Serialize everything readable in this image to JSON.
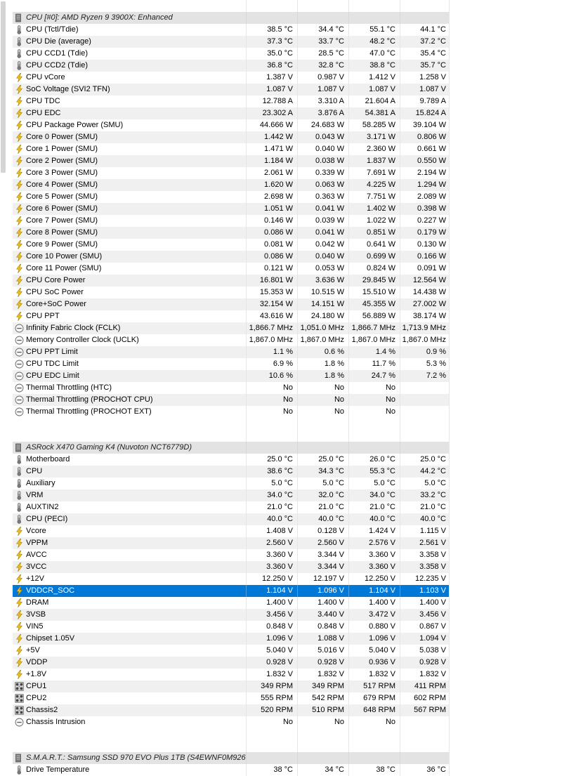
{
  "sections": [
    {
      "title": "CPU [#0]: AMD Ryzen 9 3900X: Enhanced",
      "rows": [
        {
          "icon": "thermometer-icon",
          "label": "CPU (Tctl/Tdie)",
          "v": [
            "38.5 °C",
            "34.4 °C",
            "55.1 °C",
            "44.1 °C"
          ]
        },
        {
          "icon": "thermometer-icon",
          "label": "CPU Die (average)",
          "v": [
            "37.3 °C",
            "33.7 °C",
            "48.2 °C",
            "37.2 °C"
          ]
        },
        {
          "icon": "thermometer-icon",
          "label": "CPU CCD1 (Tdie)",
          "v": [
            "35.0 °C",
            "28.5 °C",
            "47.0 °C",
            "35.4 °C"
          ]
        },
        {
          "icon": "thermometer-icon",
          "label": "CPU CCD2 (Tdie)",
          "v": [
            "36.8 °C",
            "32.8 °C",
            "38.8 °C",
            "35.7 °C"
          ]
        },
        {
          "icon": "lightning-icon",
          "label": "CPU vCore",
          "v": [
            "1.387 V",
            "0.987 V",
            "1.412 V",
            "1.258 V"
          ]
        },
        {
          "icon": "lightning-icon",
          "label": "SoC Voltage (SVI2 TFN)",
          "v": [
            "1.087 V",
            "1.087 V",
            "1.087 V",
            "1.087 V"
          ]
        },
        {
          "icon": "lightning-icon",
          "label": "CPU TDC",
          "v": [
            "12.788 A",
            "3.310 A",
            "21.604 A",
            "9.789 A"
          ]
        },
        {
          "icon": "lightning-icon",
          "label": "CPU EDC",
          "v": [
            "23.302 A",
            "3.876 A",
            "54.381 A",
            "15.824 A"
          ]
        },
        {
          "icon": "lightning-icon",
          "label": "CPU Package Power (SMU)",
          "v": [
            "44.666 W",
            "24.683 W",
            "58.285 W",
            "39.104 W"
          ]
        },
        {
          "icon": "lightning-icon",
          "label": "Core 0 Power (SMU)",
          "v": [
            "1.442 W",
            "0.043 W",
            "3.171 W",
            "0.806 W"
          ]
        },
        {
          "icon": "lightning-icon",
          "label": "Core 1 Power (SMU)",
          "v": [
            "1.471 W",
            "0.040 W",
            "2.360 W",
            "0.661 W"
          ]
        },
        {
          "icon": "lightning-icon",
          "label": "Core 2 Power (SMU)",
          "v": [
            "1.184 W",
            "0.038 W",
            "1.837 W",
            "0.550 W"
          ]
        },
        {
          "icon": "lightning-icon",
          "label": "Core 3 Power (SMU)",
          "v": [
            "2.061 W",
            "0.339 W",
            "7.691 W",
            "2.194 W"
          ]
        },
        {
          "icon": "lightning-icon",
          "label": "Core 4 Power (SMU)",
          "v": [
            "1.620 W",
            "0.063 W",
            "4.225 W",
            "1.294 W"
          ]
        },
        {
          "icon": "lightning-icon",
          "label": "Core 5 Power (SMU)",
          "v": [
            "2.698 W",
            "0.363 W",
            "7.751 W",
            "2.089 W"
          ]
        },
        {
          "icon": "lightning-icon",
          "label": "Core 6 Power (SMU)",
          "v": [
            "1.051 W",
            "0.041 W",
            "1.402 W",
            "0.398 W"
          ]
        },
        {
          "icon": "lightning-icon",
          "label": "Core 7 Power (SMU)",
          "v": [
            "0.146 W",
            "0.039 W",
            "1.022 W",
            "0.227 W"
          ]
        },
        {
          "icon": "lightning-icon",
          "label": "Core 8 Power (SMU)",
          "v": [
            "0.086 W",
            "0.041 W",
            "0.851 W",
            "0.179 W"
          ]
        },
        {
          "icon": "lightning-icon",
          "label": "Core 9 Power (SMU)",
          "v": [
            "0.081 W",
            "0.042 W",
            "0.641 W",
            "0.130 W"
          ]
        },
        {
          "icon": "lightning-icon",
          "label": "Core 10 Power (SMU)",
          "v": [
            "0.086 W",
            "0.040 W",
            "0.699 W",
            "0.166 W"
          ]
        },
        {
          "icon": "lightning-icon",
          "label": "Core 11 Power (SMU)",
          "v": [
            "0.121 W",
            "0.053 W",
            "0.824 W",
            "0.091 W"
          ]
        },
        {
          "icon": "lightning-icon",
          "label": "CPU Core Power",
          "v": [
            "16.801 W",
            "3.636 W",
            "29.845 W",
            "12.564 W"
          ]
        },
        {
          "icon": "lightning-icon",
          "label": "CPU SoC Power",
          "v": [
            "15.353 W",
            "10.515 W",
            "15.510 W",
            "14.438 W"
          ]
        },
        {
          "icon": "lightning-icon",
          "label": "Core+SoC Power",
          "v": [
            "32.154 W",
            "14.151 W",
            "45.355 W",
            "27.002 W"
          ]
        },
        {
          "icon": "lightning-icon",
          "label": "CPU PPT",
          "v": [
            "43.616 W",
            "24.180 W",
            "56.889 W",
            "38.174 W"
          ]
        },
        {
          "icon": "circle-minus-icon",
          "label": "Infinity Fabric Clock (FCLK)",
          "v": [
            "1,866.7 MHz",
            "1,051.0 MHz",
            "1,866.7 MHz",
            "1,713.9 MHz"
          ]
        },
        {
          "icon": "circle-minus-icon",
          "label": "Memory Controller Clock (UCLK)",
          "v": [
            "1,867.0 MHz",
            "1,867.0 MHz",
            "1,867.0 MHz",
            "1,867.0 MHz"
          ]
        },
        {
          "icon": "circle-minus-icon",
          "label": "CPU PPT Limit",
          "v": [
            "1.1 %",
            "0.6 %",
            "1.4 %",
            "0.9 %"
          ]
        },
        {
          "icon": "circle-minus-icon",
          "label": "CPU TDC Limit",
          "v": [
            "6.9 %",
            "1.8 %",
            "11.7 %",
            "5.3 %"
          ]
        },
        {
          "icon": "circle-minus-icon",
          "label": "CPU EDC Limit",
          "v": [
            "10.6 %",
            "1.8 %",
            "24.7 %",
            "7.2 %"
          ]
        },
        {
          "icon": "circle-minus-icon",
          "label": "Thermal Throttling (HTC)",
          "v": [
            "No",
            "No",
            "No",
            ""
          ]
        },
        {
          "icon": "circle-minus-icon",
          "label": "Thermal Throttling (PROCHOT CPU)",
          "v": [
            "No",
            "No",
            "No",
            ""
          ]
        },
        {
          "icon": "circle-minus-icon",
          "label": "Thermal Throttling (PROCHOT EXT)",
          "v": [
            "No",
            "No",
            "No",
            ""
          ]
        }
      ]
    },
    {
      "title": "ASRock X470 Gaming K4 (Nuvoton NCT6779D)",
      "rows": [
        {
          "icon": "thermometer-icon",
          "label": "Motherboard",
          "v": [
            "25.0 °C",
            "25.0 °C",
            "26.0 °C",
            "25.0 °C"
          ]
        },
        {
          "icon": "thermometer-icon",
          "label": "CPU",
          "v": [
            "38.6 °C",
            "34.3 °C",
            "55.3 °C",
            "44.2 °C"
          ]
        },
        {
          "icon": "thermometer-icon",
          "label": "Auxiliary",
          "v": [
            "5.0 °C",
            "5.0 °C",
            "5.0 °C",
            "5.0 °C"
          ]
        },
        {
          "icon": "thermometer-icon",
          "label": "VRM",
          "v": [
            "34.0 °C",
            "32.0 °C",
            "34.0 °C",
            "33.2 °C"
          ]
        },
        {
          "icon": "thermometer-icon",
          "label": "AUXTIN2",
          "v": [
            "21.0 °C",
            "21.0 °C",
            "21.0 °C",
            "21.0 °C"
          ]
        },
        {
          "icon": "thermometer-icon",
          "label": "CPU (PECI)",
          "v": [
            "40.0 °C",
            "40.0 °C",
            "40.0 °C",
            "40.0 °C"
          ]
        },
        {
          "icon": "lightning-icon",
          "label": "Vcore",
          "v": [
            "1.408 V",
            "0.128 V",
            "1.424 V",
            "1.115 V"
          ]
        },
        {
          "icon": "lightning-icon",
          "label": "VPPM",
          "v": [
            "2.560 V",
            "2.560 V",
            "2.576 V",
            "2.561 V"
          ]
        },
        {
          "icon": "lightning-icon",
          "label": "AVCC",
          "v": [
            "3.360 V",
            "3.344 V",
            "3.360 V",
            "3.358 V"
          ]
        },
        {
          "icon": "lightning-icon",
          "label": "3VCC",
          "v": [
            "3.360 V",
            "3.344 V",
            "3.360 V",
            "3.358 V"
          ]
        },
        {
          "icon": "lightning-icon",
          "label": "+12V",
          "v": [
            "12.250 V",
            "12.197 V",
            "12.250 V",
            "12.235 V"
          ]
        },
        {
          "icon": "lightning-icon",
          "label": "VDDCR_SOC",
          "v": [
            "1.104 V",
            "1.096 V",
            "1.104 V",
            "1.103 V"
          ],
          "selected": true
        },
        {
          "icon": "lightning-icon",
          "label": "DRAM",
          "v": [
            "1.400 V",
            "1.400 V",
            "1.400 V",
            "1.400 V"
          ]
        },
        {
          "icon": "lightning-icon",
          "label": "3VSB",
          "v": [
            "3.456 V",
            "3.440 V",
            "3.472 V",
            "3.456 V"
          ]
        },
        {
          "icon": "lightning-icon",
          "label": "VIN5",
          "v": [
            "0.848 V",
            "0.848 V",
            "0.880 V",
            "0.867 V"
          ]
        },
        {
          "icon": "lightning-icon",
          "label": "Chipset 1.05V",
          "v": [
            "1.096 V",
            "1.088 V",
            "1.096 V",
            "1.094 V"
          ]
        },
        {
          "icon": "lightning-icon",
          "label": "+5V",
          "v": [
            "5.040 V",
            "5.016 V",
            "5.040 V",
            "5.038 V"
          ]
        },
        {
          "icon": "lightning-icon",
          "label": "VDDP",
          "v": [
            "0.928 V",
            "0.928 V",
            "0.936 V",
            "0.928 V"
          ]
        },
        {
          "icon": "lightning-icon",
          "label": "+1.8V",
          "v": [
            "1.832 V",
            "1.832 V",
            "1.832 V",
            "1.832 V"
          ]
        },
        {
          "icon": "fan-icon",
          "label": "CPU1",
          "v": [
            "349 RPM",
            "349 RPM",
            "517 RPM",
            "411 RPM"
          ]
        },
        {
          "icon": "fan-icon",
          "label": "CPU2",
          "v": [
            "555 RPM",
            "542 RPM",
            "679 RPM",
            "602 RPM"
          ]
        },
        {
          "icon": "fan-icon",
          "label": "Chassis2",
          "v": [
            "520 RPM",
            "510 RPM",
            "648 RPM",
            "567 RPM"
          ]
        },
        {
          "icon": "circle-minus-icon",
          "label": "Chassis Intrusion",
          "v": [
            "No",
            "No",
            "No",
            ""
          ]
        }
      ]
    },
    {
      "title": "S.M.A.R.T.: Samsung SSD 970 EVO Plus 1TB (S4EWNF0M926...",
      "rows": [
        {
          "icon": "thermometer-icon",
          "label": "Drive Temperature",
          "v": [
            "38 °C",
            "34 °C",
            "38 °C",
            "36 °C"
          ]
        }
      ]
    }
  ]
}
